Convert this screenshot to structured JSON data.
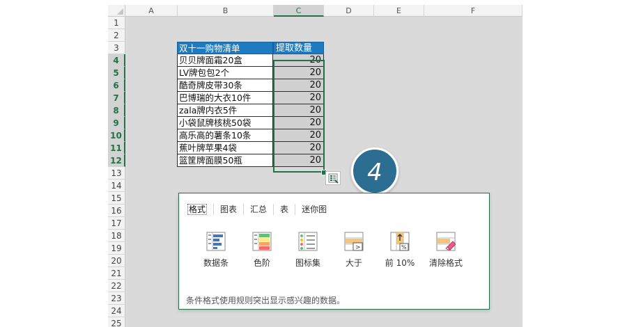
{
  "columns": [
    "A",
    "B",
    "C",
    "D",
    "E",
    "F"
  ],
  "rows": [
    "1",
    "2",
    "3",
    "4",
    "5",
    "6",
    "7",
    "8",
    "9",
    "10",
    "11",
    "12",
    "13",
    "14",
    "15",
    "16",
    "17",
    "18",
    "19",
    "20",
    "21",
    "22",
    "23",
    "24",
    "25"
  ],
  "table": {
    "headers": [
      "双十一购物清单",
      "提取数量"
    ],
    "items": [
      [
        "贝贝牌面霜20盒",
        "20"
      ],
      [
        "LV牌包包2个",
        "20"
      ],
      [
        "酷奇牌皮带30条",
        "20"
      ],
      [
        "巴博瑞的大衣10件",
        "20"
      ],
      [
        "zala牌内衣5件",
        "20"
      ],
      [
        "小袋鼠牌核桃50袋",
        "20"
      ],
      [
        "高乐高的薯条10条",
        "20"
      ],
      [
        "蕉叶牌苹果4袋",
        "20"
      ],
      [
        "篮筐牌面膜50瓶",
        "20"
      ]
    ]
  },
  "badge": "4",
  "quick_analysis": {
    "tabs": [
      "格式",
      "图表",
      "汇总",
      "表",
      "迷你图"
    ],
    "tools": [
      {
        "label": "数据条",
        "icon": "data-bars-icon"
      },
      {
        "label": "色阶",
        "icon": "color-scale-icon"
      },
      {
        "label": "图标集",
        "icon": "icon-set-icon"
      },
      {
        "label": "大于",
        "icon": "greater-than-icon"
      },
      {
        "label": "前 10%",
        "icon": "top-10-percent-icon"
      },
      {
        "label": "清除格式",
        "icon": "clear-format-icon"
      }
    ],
    "hint": "条件格式使用规则突出显示感兴趣的数据。"
  },
  "colors": {
    "header_fill": "#1f7bc1",
    "selection": "#217346",
    "badge": "#2c6e92",
    "selected_fill": "#d0d0d0"
  }
}
